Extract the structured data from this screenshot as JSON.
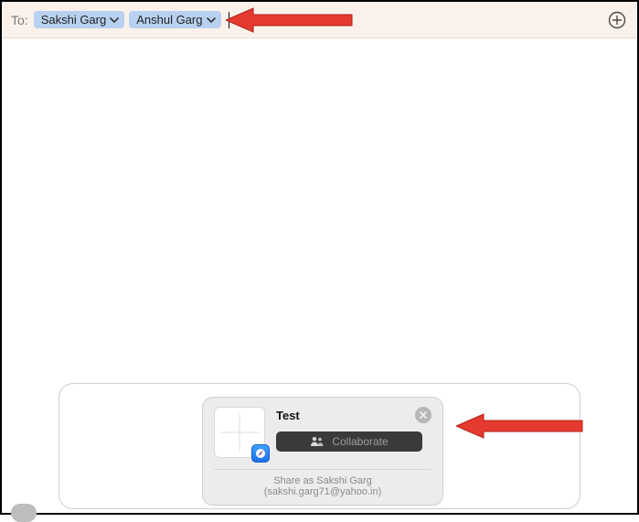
{
  "to": {
    "label": "To:",
    "recipients": [
      {
        "name": "Sakshi Garg"
      },
      {
        "name": "Anshul Garg"
      }
    ]
  },
  "icons": {
    "chevron_down": "chevron-down-icon",
    "plus_circle": "plus-circle-icon",
    "close": "close-icon",
    "people": "people-icon",
    "safari": "safari-icon"
  },
  "share_card": {
    "title": "Test",
    "collaborate_label": "Collaborate",
    "share_as_text": "Share as Sakshi Garg (sakshi.garg71@yahoo.in)"
  },
  "annotations": {
    "arrow_top": "arrow-pointing-to-recipients",
    "arrow_bottom": "arrow-pointing-to-collaborate"
  },
  "colors": {
    "chip_bg": "#b9d1f0",
    "tobar_bg": "#faf1eb",
    "collab_bg": "#3a3a3a",
    "arrow_fill": "#e53a2f"
  }
}
